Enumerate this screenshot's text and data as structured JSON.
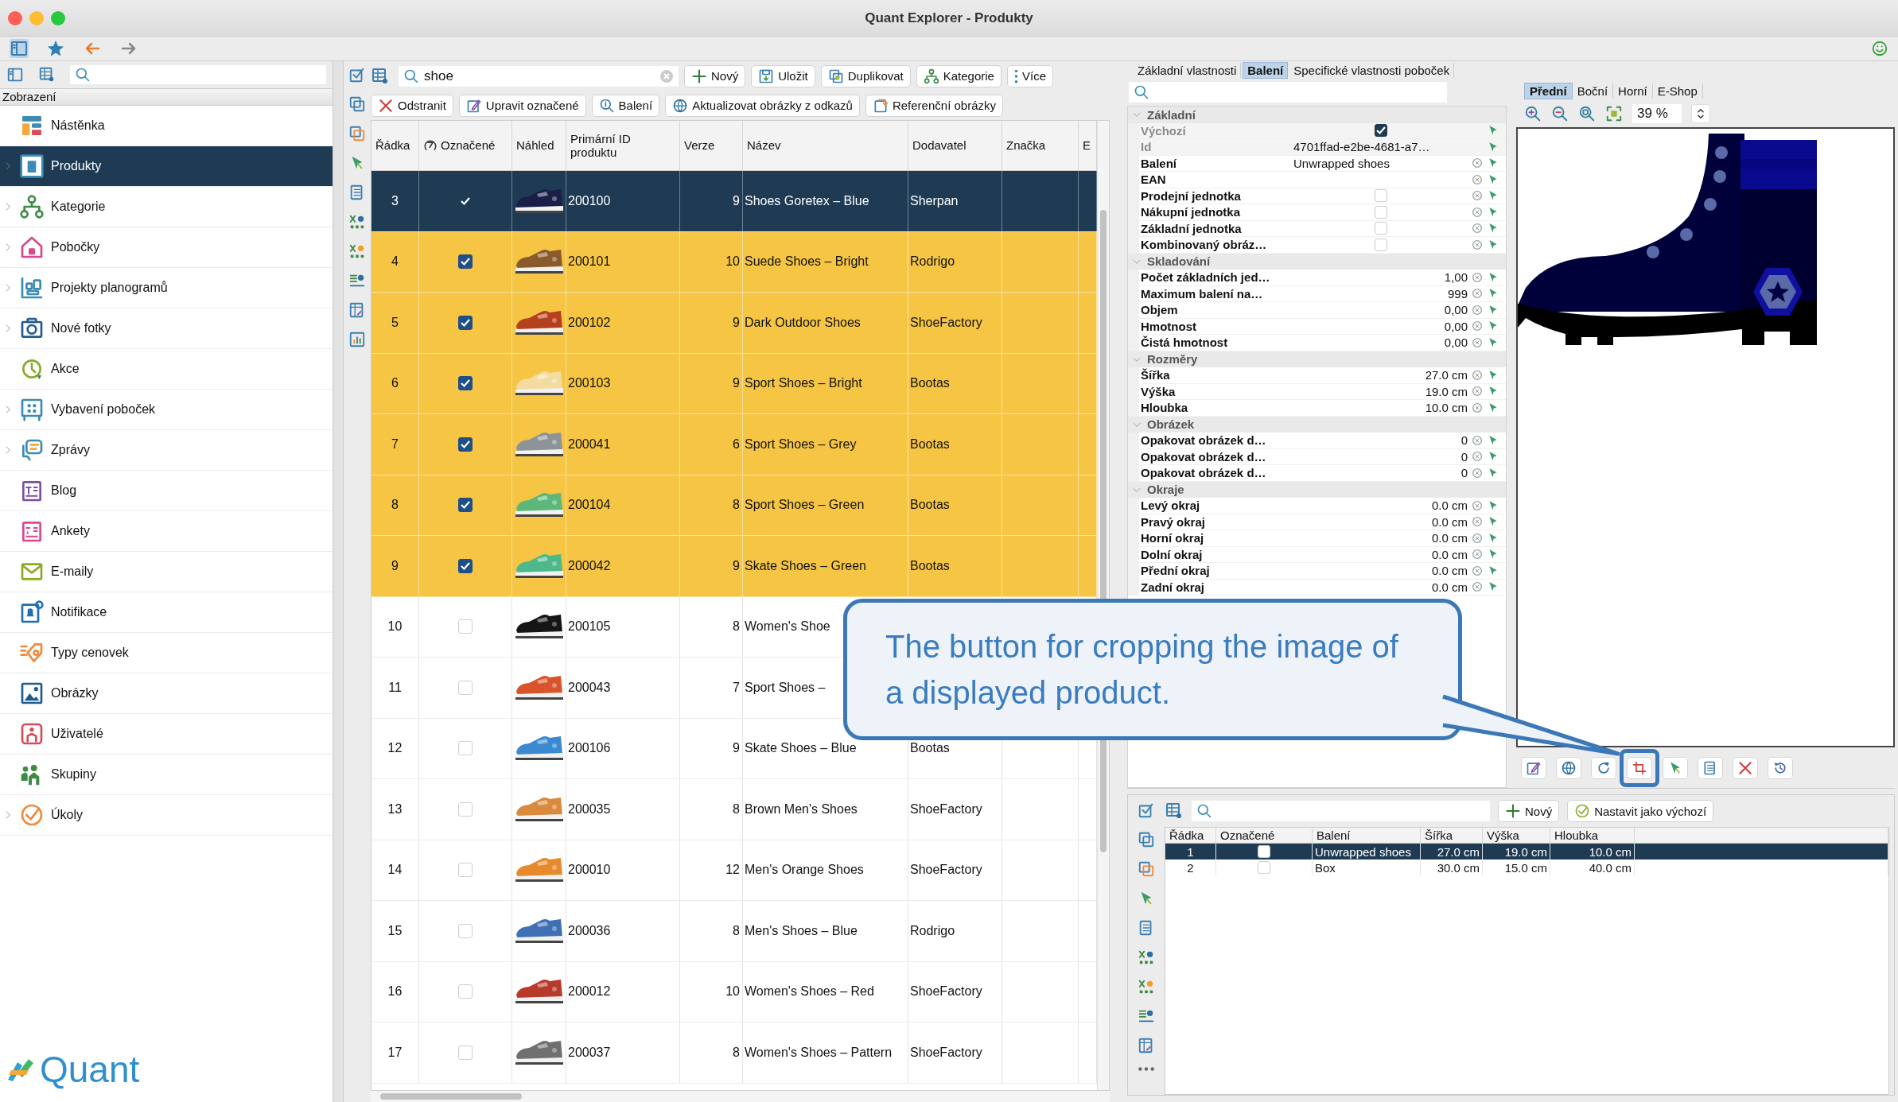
{
  "window": {
    "title": "Quant Explorer - Produkty"
  },
  "sidebar": {
    "header": "Zobrazení",
    "logo": "Quant",
    "items": [
      {
        "label": "Nástěnka",
        "expandable": false,
        "selected": false
      },
      {
        "label": "Produkty",
        "expandable": true,
        "selected": true
      },
      {
        "label": "Kategorie",
        "expandable": true,
        "selected": false
      },
      {
        "label": "Pobočky",
        "expandable": true,
        "selected": false
      },
      {
        "label": "Projekty planogramů",
        "expandable": true,
        "selected": false
      },
      {
        "label": "Nové fotky",
        "expandable": true,
        "selected": false
      },
      {
        "label": "Akce",
        "expandable": false,
        "selected": false
      },
      {
        "label": "Vybavení poboček",
        "expandable": true,
        "selected": false
      },
      {
        "label": "Zprávy",
        "expandable": true,
        "selected": false
      },
      {
        "label": "Blog",
        "expandable": false,
        "selected": false
      },
      {
        "label": "Ankety",
        "expandable": false,
        "selected": false
      },
      {
        "label": "E-maily",
        "expandable": false,
        "selected": false
      },
      {
        "label": "Notifikace",
        "expandable": false,
        "selected": false
      },
      {
        "label": "Typy cenovek",
        "expandable": false,
        "selected": false
      },
      {
        "label": "Obrázky",
        "expandable": false,
        "selected": false
      },
      {
        "label": "Uživatelé",
        "expandable": false,
        "selected": false
      },
      {
        "label": "Skupiny",
        "expandable": false,
        "selected": false
      },
      {
        "label": "Úkoly",
        "expandable": true,
        "selected": false
      }
    ]
  },
  "products": {
    "search": {
      "value": "shoe"
    },
    "toolbar": [
      {
        "label": "Nový"
      },
      {
        "label": "Uložit"
      },
      {
        "label": "Duplikovat"
      },
      {
        "label": "Kategorie"
      },
      {
        "label": "Více"
      }
    ],
    "actions": [
      {
        "label": "Odstranit"
      },
      {
        "label": "Upravit označené"
      },
      {
        "label": "Balení"
      },
      {
        "label": "Aktualizovat obrázky z odkazů"
      },
      {
        "label": "Referenční obrázky"
      }
    ],
    "columns": [
      "Řádka",
      "Označené",
      "Náhled",
      "Primární ID produktu",
      "Verze",
      "Název",
      "Dodavatel",
      "Značka",
      "E"
    ],
    "rows": [
      {
        "row": "3",
        "checked": true,
        "selected": true,
        "id": "200100",
        "version": "9",
        "name": "Shoes Goretex – Blue",
        "supplier": "Sherpan"
      },
      {
        "row": "4",
        "checked": true,
        "selected": false,
        "id": "200101",
        "version": "10",
        "name": "Suede Shoes – Bright",
        "supplier": "Rodrigo"
      },
      {
        "row": "5",
        "checked": true,
        "selected": false,
        "id": "200102",
        "version": "9",
        "name": "Dark Outdoor Shoes",
        "supplier": "ShoeFactory"
      },
      {
        "row": "6",
        "checked": true,
        "selected": false,
        "id": "200103",
        "version": "9",
        "name": "Sport Shoes – Bright",
        "supplier": "Bootas"
      },
      {
        "row": "7",
        "checked": true,
        "selected": false,
        "id": "200041",
        "version": "6",
        "name": "Sport Shoes – Grey",
        "supplier": "Bootas"
      },
      {
        "row": "8",
        "checked": true,
        "selected": false,
        "id": "200104",
        "version": "8",
        "name": "Sport Shoes – Green",
        "supplier": "Bootas"
      },
      {
        "row": "9",
        "checked": true,
        "selected": false,
        "id": "200042",
        "version": "9",
        "name": "Skate Shoes – Green",
        "supplier": "Bootas"
      },
      {
        "row": "10",
        "checked": false,
        "selected": false,
        "id": "200105",
        "version": "8",
        "name": "Women's Shoe"
      },
      {
        "row": "11",
        "checked": false,
        "selected": false,
        "id": "200043",
        "version": "7",
        "name": "Sport Shoes –"
      },
      {
        "row": "12",
        "checked": false,
        "selected": false,
        "id": "200106",
        "version": "9",
        "name": "Skate Shoes – Blue",
        "supplier": "Bootas"
      },
      {
        "row": "13",
        "checked": false,
        "selected": false,
        "id": "200035",
        "version": "8",
        "name": "Brown Men's Shoes",
        "supplier": "ShoeFactory"
      },
      {
        "row": "14",
        "checked": false,
        "selected": false,
        "id": "200010",
        "version": "12",
        "name": "Men's Orange Shoes",
        "supplier": "ShoeFactory"
      },
      {
        "row": "15",
        "checked": false,
        "selected": false,
        "id": "200036",
        "version": "8",
        "name": "Men's Shoes – Blue",
        "supplier": "Rodrigo"
      },
      {
        "row": "16",
        "checked": false,
        "selected": false,
        "id": "200012",
        "version": "10",
        "name": "Women's Shoes – Red",
        "supplier": "ShoeFactory"
      },
      {
        "row": "17",
        "checked": false,
        "selected": false,
        "id": "200037",
        "version": "8",
        "name": "Women's Shoes – Pattern",
        "supplier": "ShoeFactory"
      }
    ]
  },
  "properties": {
    "tabs": [
      {
        "label": "Základní vlastnosti",
        "selected": false
      },
      {
        "label": "Balení",
        "selected": true
      },
      {
        "label": "Specifické vlastnosti poboček",
        "selected": false
      }
    ],
    "groups": [
      {
        "title": "Základní",
        "expanded": true,
        "rows": [
          {
            "label": "Výchozí",
            "kind": "checkbox",
            "checked": true,
            "readonly": true
          },
          {
            "label": "Id",
            "kind": "text",
            "value": "4701ffad-e2be-4681-a7…",
            "readonly": true
          },
          {
            "label": "Balení",
            "kind": "text",
            "value": "Unwrapped shoes",
            "readonly": false
          },
          {
            "label": "EAN",
            "kind": "text",
            "readonly": false
          },
          {
            "label": "Prodejní jednotka",
            "kind": "checkbox",
            "checked": false,
            "readonly": false
          },
          {
            "label": "Nákupní jednotka",
            "kind": "checkbox",
            "checked": false,
            "readonly": false
          },
          {
            "label": "Základní jednotka",
            "kind": "checkbox",
            "checked": false,
            "readonly": false
          },
          {
            "label": "Kombinovaný obráz…",
            "kind": "checkbox",
            "checked": false,
            "readonly": false
          }
        ]
      },
      {
        "title": "Skladování",
        "expanded": true,
        "rows": [
          {
            "label": "Počet základních jed…",
            "kind": "number",
            "value": "1,00",
            "readonly": false
          },
          {
            "label": "Maximum balení na…",
            "kind": "number",
            "value": "999",
            "readonly": false
          },
          {
            "label": "Objem",
            "kind": "number",
            "value": "0,00",
            "readonly": false
          },
          {
            "label": "Hmotnost",
            "kind": "number",
            "value": "0,00",
            "readonly": false
          },
          {
            "label": "Čistá hmotnost",
            "kind": "number",
            "value": "0,00",
            "readonly": false
          }
        ]
      },
      {
        "title": "Rozměry",
        "expanded": true,
        "rows": [
          {
            "label": "Šířka",
            "kind": "number",
            "value": "27.0 cm",
            "readonly": false
          },
          {
            "label": "Výška",
            "kind": "number",
            "value": "19.0 cm",
            "readonly": false
          },
          {
            "label": "Hloubka",
            "kind": "number",
            "value": "10.0 cm",
            "readonly": false
          }
        ]
      },
      {
        "title": "Obrázek",
        "expanded": true,
        "rows": [
          {
            "label": "Opakovat obrázek d…",
            "kind": "number",
            "value": "0",
            "readonly": false
          },
          {
            "label": "Opakovat obrázek d…",
            "kind": "number",
            "value": "0",
            "readonly": false
          },
          {
            "label": "Opakovat obrázek d…",
            "kind": "number",
            "value": "0",
            "readonly": false
          }
        ]
      },
      {
        "title": "Okraje",
        "expanded": true,
        "rows": [
          {
            "label": "Levý okraj",
            "kind": "number",
            "value": "0.0 cm",
            "readonly": false
          },
          {
            "label": "Pravý okraj",
            "kind": "number",
            "value": "0.0 cm",
            "readonly": false
          },
          {
            "label": "Horní okraj",
            "kind": "number",
            "value": "0.0 cm",
            "readonly": false
          },
          {
            "label": "Dolní okraj",
            "kind": "number",
            "value": "0.0 cm",
            "readonly": false
          },
          {
            "label": "Přední okraj",
            "kind": "number",
            "value": "0.0 cm",
            "readonly": false
          },
          {
            "label": "Zadní okraj",
            "kind": "number",
            "value": "0.0 cm",
            "readonly": false
          }
        ]
      }
    ]
  },
  "image_panel": {
    "tabs": [
      {
        "label": "Přední",
        "selected": true
      },
      {
        "label": "Boční",
        "selected": false
      },
      {
        "label": "Horní",
        "selected": false
      },
      {
        "label": "E-Shop",
        "selected": false
      }
    ],
    "zoom": "39 %"
  },
  "packaging": {
    "toolbar": [
      {
        "label": "Nový"
      },
      {
        "label": "Nastavit jako výchozí"
      }
    ],
    "columns": [
      "Řádka",
      "Označené",
      "Balení",
      "Šířka",
      "Výška",
      "Hloubka"
    ],
    "rows": [
      {
        "row": "1",
        "checked": false,
        "selected": true,
        "name": "Unwrapped shoes",
        "width": "27.0 cm",
        "height": "19.0 cm",
        "depth": "10.0 cm"
      },
      {
        "row": "2",
        "checked": false,
        "selected": false,
        "name": "Box",
        "width": "30.0 cm",
        "height": "15.0 cm",
        "depth": "40.0 cm"
      }
    ]
  },
  "callout": {
    "text": "The button for cropping the image of a displayed product."
  }
}
